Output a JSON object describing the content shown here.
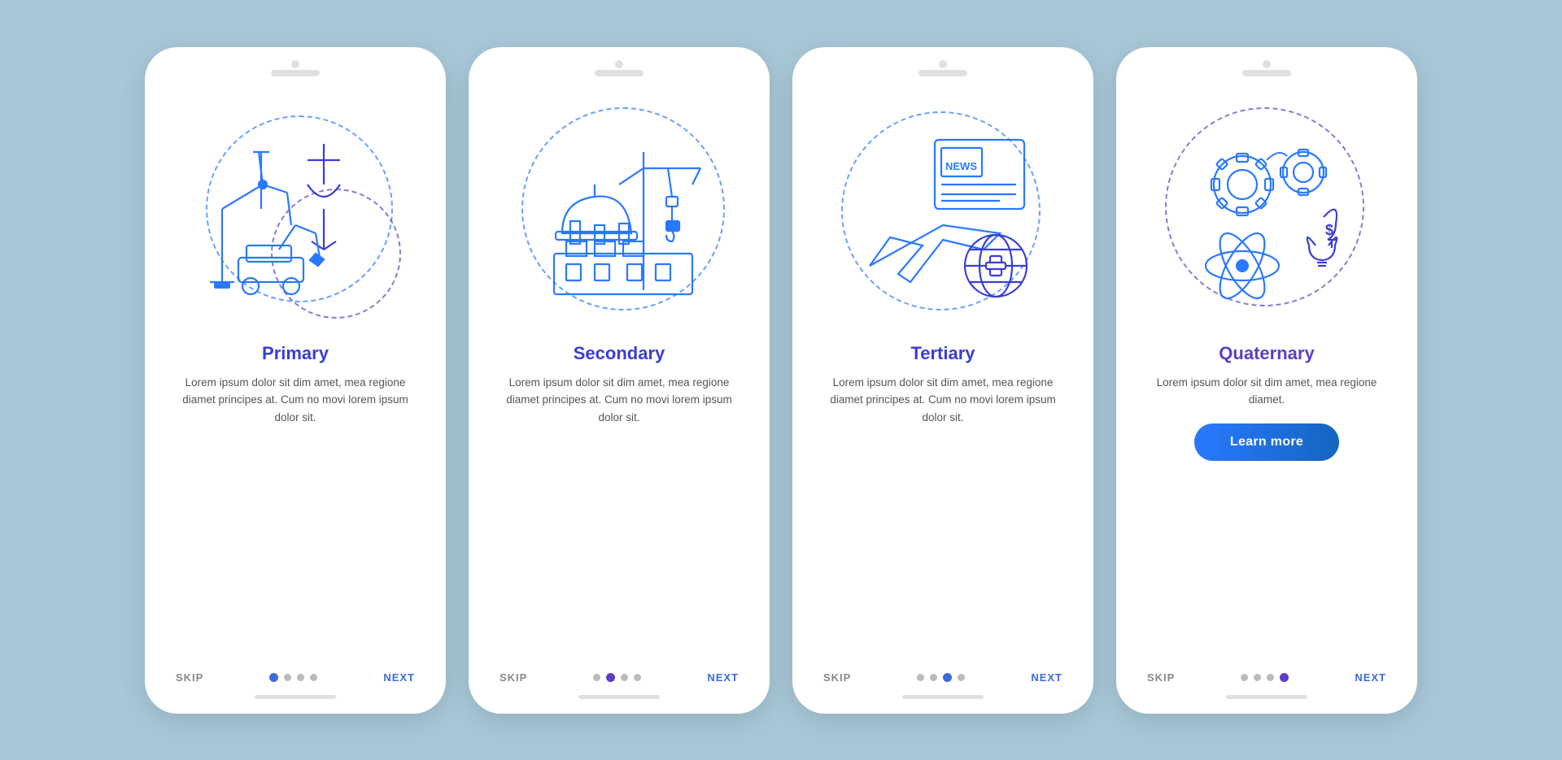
{
  "phones": [
    {
      "id": "primary",
      "title": "Primary",
      "title_color": "blue",
      "description": "Lorem ipsum dolor sit dim amet, mea regione diamet principes at. Cum no movi lorem ipsum dolor sit.",
      "dots": [
        true,
        false,
        false,
        false
      ],
      "dot_style": "blue",
      "show_learn_more": false,
      "skip_label": "SKIP",
      "next_label": "NEXT"
    },
    {
      "id": "secondary",
      "title": "Secondary",
      "title_color": "blue",
      "description": "Lorem ipsum dolor sit dim amet, mea regione diamet principes at. Cum no movi lorem ipsum dolor sit.",
      "dots": [
        false,
        true,
        false,
        false
      ],
      "dot_style": "purple",
      "show_learn_more": false,
      "skip_label": "SKIP",
      "next_label": "NEXT"
    },
    {
      "id": "tertiary",
      "title": "Tertiary",
      "title_color": "blue",
      "description": "Lorem ipsum dolor sit dim amet, mea regione diamet principes at. Cum no movi lorem ipsum dolor sit.",
      "dots": [
        false,
        false,
        true,
        false
      ],
      "dot_style": "blue",
      "show_learn_more": false,
      "skip_label": "SKIP",
      "next_label": "NEXT"
    },
    {
      "id": "quaternary",
      "title": "Quaternary",
      "title_color": "purple",
      "description": "Lorem ipsum dolor sit dim amet, mea regione diamet.",
      "dots": [
        false,
        false,
        false,
        true
      ],
      "dot_style": "purple",
      "show_learn_more": true,
      "learn_more_label": "Learn more",
      "skip_label": "SKIP",
      "next_label": "NEXT"
    }
  ]
}
